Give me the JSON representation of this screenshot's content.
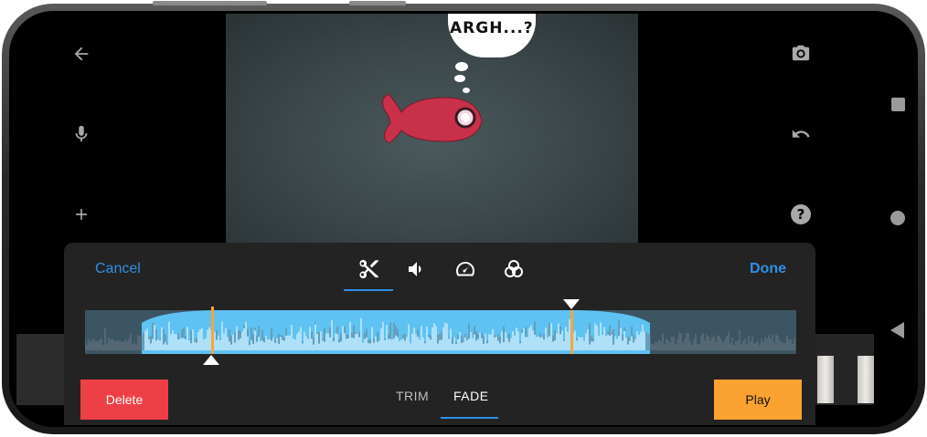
{
  "video": {
    "bubble_text": "ARGH...?"
  },
  "left_toolbar": {
    "back_icon": "arrow-left-icon",
    "mic_icon": "microphone-icon",
    "add_icon": "plus-icon"
  },
  "right_toolbar": {
    "camera_icon": "camera-icon",
    "undo_icon": "undo-icon",
    "help_icon": "help-icon"
  },
  "editor": {
    "cancel_label": "Cancel",
    "done_label": "Done",
    "tools": [
      {
        "name": "scissors-icon",
        "active": true
      },
      {
        "name": "volume-icon",
        "active": false
      },
      {
        "name": "speedometer-icon",
        "active": false
      },
      {
        "name": "color-filter-icon",
        "active": false
      }
    ],
    "tabs": [
      {
        "label": "TRIM",
        "active": false
      },
      {
        "label": "FADE",
        "active": true
      }
    ],
    "delete_label": "Delete",
    "play_label": "Play"
  },
  "colors": {
    "accent": "#2f8fe6",
    "delete": "#ef3f46",
    "play": "#fba330",
    "waveform_selected": "#5ec2f2"
  }
}
